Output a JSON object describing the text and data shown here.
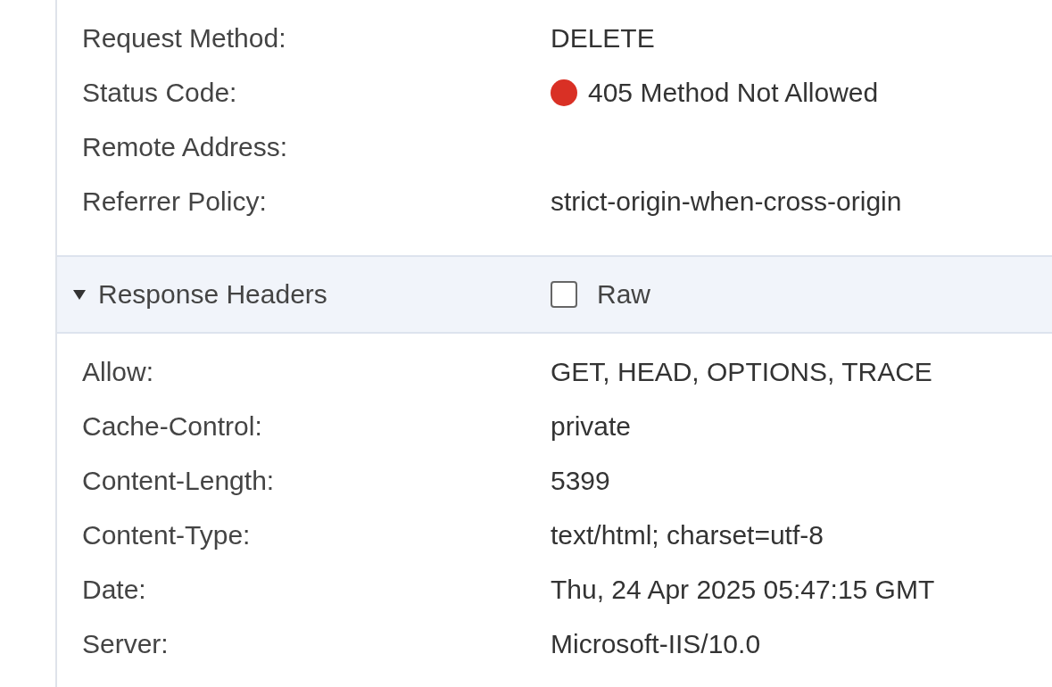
{
  "general": [
    {
      "label": "Request Method:",
      "value": "DELETE"
    },
    {
      "label": "Status Code:",
      "value": "405 Method Not Allowed",
      "color": "#d93025"
    },
    {
      "label": "Remote Address:"
    },
    {
      "label": "Referrer Policy:",
      "value": "strict-origin-when-cross-origin"
    }
  ],
  "response_headers": {
    "title": "Response Headers",
    "expanded": true,
    "raw": {
      "label": "Raw",
      "checked": false
    },
    "rows": [
      {
        "label": "Allow:",
        "value": "GET, HEAD, OPTIONS, TRACE"
      },
      {
        "label": "Cache-Control:",
        "value": "private"
      },
      {
        "label": "Content-Length:",
        "value": "5399"
      },
      {
        "label": "Content-Type:",
        "value": "text/html; charset=utf-8"
      },
      {
        "label": "Date:",
        "value": "Thu, 24 Apr 2025 05:47:15 GMT"
      },
      {
        "label": "Server:",
        "value": "Microsoft-IIS/10.0"
      }
    ]
  }
}
